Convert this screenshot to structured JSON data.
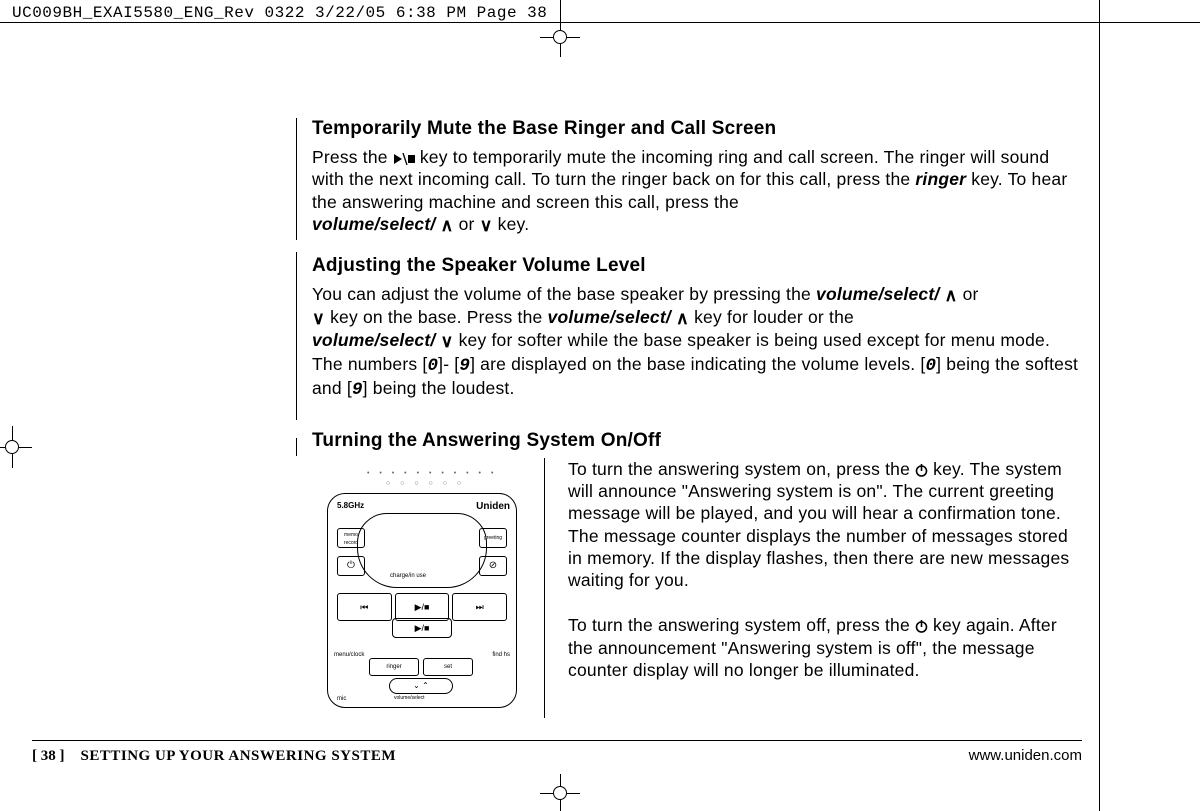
{
  "header_line": "UC009BH_EXAI5580_ENG_Rev 0322  3/22/05  6:38 PM  Page 38",
  "section1": {
    "title": "Temporarily Mute the Base Ringer and Call Screen",
    "p1a": "Press the ",
    "p1b": " key to temporarily mute the incoming ring and call screen. The ringer will sound with the next incoming call. To turn the ringer back on for this call, press the ",
    "ringer": "ringer",
    "p1c": " key. To hear the answering machine and screen this call, press the ",
    "vs": "volume/select/",
    "p1d": " or ",
    "p1e": " key."
  },
  "section2": {
    "title": "Adjusting the Speaker Volume Level",
    "p_a": "You can adjust the volume of the base speaker by pressing the ",
    "vs": "volume/select/",
    "p_b": " or ",
    "p_c": " key on the base. Press the ",
    "p_d": " key for louder or the ",
    "p_e": " key for softer while the base speaker is being used except for menu mode. The numbers [",
    "d0": "0",
    "p_f": "]- [",
    "d9": "9",
    "p_g": "] are displayed on the base indicating the volume levels.  [",
    "p_h": "] being the softest and [",
    "p_i": "] being the loudest."
  },
  "section3": {
    "title": "Turning the Answering System On/Off",
    "p1a": "To turn the answering system on, press the ",
    "p1b": " key. The system will announce \"Answering system is on\". The current greeting message will be played, and you will hear a confirmation tone. The message counter displays the number of messages stored in memory. If the display flashes, then there are new messages waiting for you.",
    "p2a": "To turn the answering system off, press the ",
    "p2b": " key again. After the announcement \"Answering system is off\", the message counter display will no longer be illuminated."
  },
  "device": {
    "freq": "5.8GHz",
    "brand": "Uniden",
    "memo": "memo record",
    "greeting": "greeting",
    "charge": "charge/in use",
    "rew": "⏮",
    "play": "▶/■",
    "fwd": "⏭",
    "menu": "menu/clock",
    "find": "find hs",
    "ringer": "ringer",
    "set": "set",
    "vol": "⌄  ⌃",
    "vol_label": "volume/select",
    "mic": "mic",
    "power": "⏻",
    "cancel": "⊘"
  },
  "footer": {
    "page": "[ 38 ]",
    "title": "SETTING UP YOUR ANSWERING SYSTEM",
    "url": "www.uniden.com"
  }
}
